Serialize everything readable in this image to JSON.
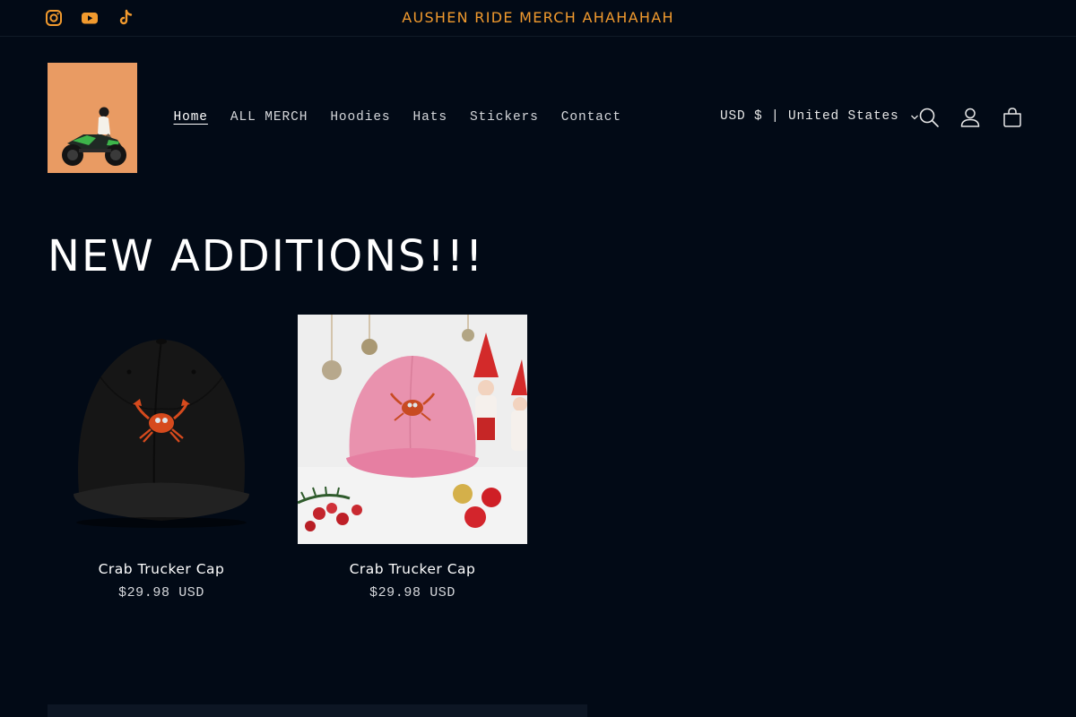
{
  "announcement": {
    "text": "AUSHEN RIDE MERCH AHAHAHAH"
  },
  "socials": [
    {
      "icon": "instagram-icon"
    },
    {
      "icon": "youtube-icon"
    },
    {
      "icon": "tiktok-icon"
    }
  ],
  "nav": {
    "items": [
      {
        "label": "Home",
        "active": true
      },
      {
        "label": "ALL MERCH"
      },
      {
        "label": "Hoodies"
      },
      {
        "label": "Hats"
      },
      {
        "label": "Stickers"
      },
      {
        "label": "Contact"
      }
    ]
  },
  "locale": {
    "label": "USD $ | United States"
  },
  "header_icons": [
    "search-icon",
    "account-icon",
    "cart-icon"
  ],
  "section": {
    "heading": "NEW ADDITIONS!!!"
  },
  "products": [
    {
      "title": "Crab Trucker Cap",
      "price": "$29.98 USD"
    },
    {
      "title": "Crab Trucker Cap",
      "price": "$29.98 USD"
    }
  ],
  "colors": {
    "background": "#020a16",
    "accent": "#f19a2e",
    "logo_bg": "#e99b63"
  }
}
